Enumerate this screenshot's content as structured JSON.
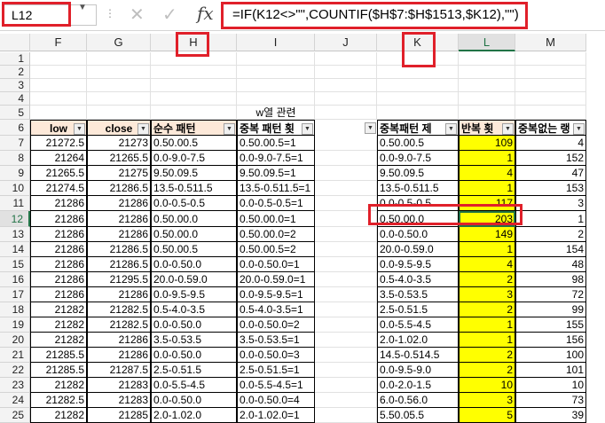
{
  "formula_bar": {
    "name_box": "L12",
    "formula": "=IF(K12<>\"\",COUNTIF($H$7:$H$1513,$K12),\"\")",
    "fx_label": "fx",
    "cancel_icon": "close-icon",
    "enter_icon": "check-icon"
  },
  "columns": [
    "F",
    "G",
    "H",
    "I",
    "J",
    "K",
    "L",
    "M"
  ],
  "row_numbers": [
    "1",
    "2",
    "3",
    "4",
    "5",
    "6",
    "7",
    "8",
    "9",
    "10",
    "11",
    "12",
    "13",
    "14",
    "15",
    "16",
    "17",
    "18",
    "19",
    "20",
    "21",
    "22",
    "23",
    "24",
    "25"
  ],
  "merged_label": "w열 관련",
  "headers": {
    "F": "low",
    "G": "close",
    "H": "순수 패턴",
    "I": "중복 패턴 횟",
    "K": "중복패턴 제",
    "L": "반복 횟",
    "M": "중복없는 랭"
  },
  "rows": [
    {
      "F": "21272.5",
      "G": "21273",
      "H": "0.50.00.5",
      "I": "0.50.00.5=1",
      "K": "0.50.00.5",
      "L": "109",
      "M": "4"
    },
    {
      "F": "21264",
      "G": "21265.5",
      "H": "0.0-9.0-7.5",
      "I": "0.0-9.0-7.5=1",
      "K": "0.0-9.0-7.5",
      "L": "1",
      "M": "152"
    },
    {
      "F": "21265.5",
      "G": "21275",
      "H": "9.50.09.5",
      "I": "9.50.09.5=1",
      "K": "9.50.09.5",
      "L": "4",
      "M": "47"
    },
    {
      "F": "21274.5",
      "G": "21286.5",
      "H": "13.5-0.511.5",
      "I": "13.5-0.511.5=1",
      "K": "13.5-0.511.5",
      "L": "1",
      "M": "153"
    },
    {
      "F": "21286",
      "G": "21286",
      "H": "0.0-0.5-0.5",
      "I": "0.0-0.5-0.5=1",
      "K": "0.0-0.5-0.5",
      "L": "117",
      "M": "3"
    },
    {
      "F": "21286",
      "G": "21286",
      "H": "0.50.00.0",
      "I": "0.50.00.0=1",
      "K": "0.50.00.0",
      "L": "203",
      "M": "1"
    },
    {
      "F": "21286",
      "G": "21286",
      "H": "0.50.00.0",
      "I": "0.50.00.0=2",
      "K": "0.0-0.50.0",
      "L": "149",
      "M": "2"
    },
    {
      "F": "21286",
      "G": "21286.5",
      "H": "0.50.00.5",
      "I": "0.50.00.5=2",
      "K": "20.0-0.59.0",
      "L": "1",
      "M": "154"
    },
    {
      "F": "21286",
      "G": "21286.5",
      "H": "0.0-0.50.0",
      "I": "0.0-0.50.0=1",
      "K": "0.0-9.5-9.5",
      "L": "4",
      "M": "48"
    },
    {
      "F": "21286",
      "G": "21295.5",
      "H": "20.0-0.59.0",
      "I": "20.0-0.59.0=1",
      "K": "0.5-4.0-3.5",
      "L": "2",
      "M": "98"
    },
    {
      "F": "21286",
      "G": "21286",
      "H": "0.0-9.5-9.5",
      "I": "0.0-9.5-9.5=1",
      "K": "3.5-0.53.5",
      "L": "3",
      "M": "72"
    },
    {
      "F": "21282",
      "G": "21282.5",
      "H": "0.5-4.0-3.5",
      "I": "0.5-4.0-3.5=1",
      "K": "2.5-0.51.5",
      "L": "2",
      "M": "99"
    },
    {
      "F": "21282",
      "G": "21282.5",
      "H": "0.0-0.50.0",
      "I": "0.0-0.50.0=2",
      "K": "0.0-5.5-4.5",
      "L": "1",
      "M": "155"
    },
    {
      "F": "21282",
      "G": "21286",
      "H": "3.5-0.53.5",
      "I": "3.5-0.53.5=1",
      "K": "2.0-1.02.0",
      "L": "1",
      "M": "156"
    },
    {
      "F": "21285.5",
      "G": "21286",
      "H": "0.0-0.50.0",
      "I": "0.0-0.50.0=3",
      "K": "14.5-0.514.5",
      "L": "2",
      "M": "100"
    },
    {
      "F": "21285.5",
      "G": "21287.5",
      "H": "2.5-0.51.5",
      "I": "2.5-0.51.5=1",
      "K": "0.0-9.5-9.0",
      "L": "2",
      "M": "101"
    },
    {
      "F": "21282",
      "G": "21283",
      "H": "0.0-5.5-4.5",
      "I": "0.0-5.5-4.5=1",
      "K": "0.0-2.0-1.5",
      "L": "10",
      "M": "10"
    },
    {
      "F": "21282.5",
      "G": "21283",
      "H": "0.0-0.50.0",
      "I": "0.0-0.50.0=4",
      "K": "6.0-0.56.0",
      "L": "3",
      "M": "73"
    },
    {
      "F": "21282",
      "G": "21285",
      "H": "2.0-1.02.0",
      "I": "2.0-1.02.0=1",
      "K": "5.50.05.5",
      "L": "5",
      "M": "39"
    }
  ],
  "colors": {
    "header_fill": "#fde9d9",
    "highlight_fill": "#ffff00",
    "annotation_red": "#e0202a",
    "selection_green": "#217346"
  }
}
